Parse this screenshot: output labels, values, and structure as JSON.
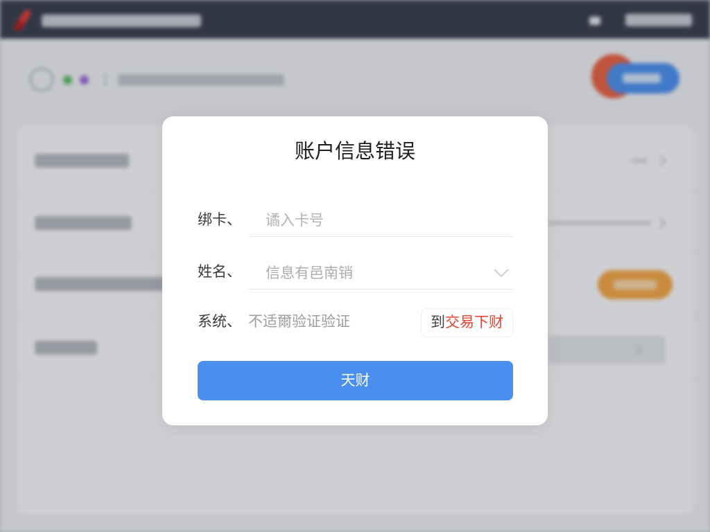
{
  "dialog": {
    "title": "账户信息错误",
    "card_field": {
      "label": "绑卡、",
      "placeholder": "谲入卡号"
    },
    "name_field": {
      "label": "姓名、",
      "value": "信息有邑南销",
      "icon": "chevron-down-icon"
    },
    "system_field": {
      "label": "系统、",
      "placeholder": "不适爾验证验证",
      "action_prefix": "到",
      "action_highlight": "交易下财"
    },
    "submit_label": "天财"
  },
  "colors": {
    "primary": "#4a8ff0",
    "highlight": "#e5432e",
    "top_bar": "#383d4c",
    "brand": "#e53935",
    "accent_orange": "#f4a543"
  }
}
